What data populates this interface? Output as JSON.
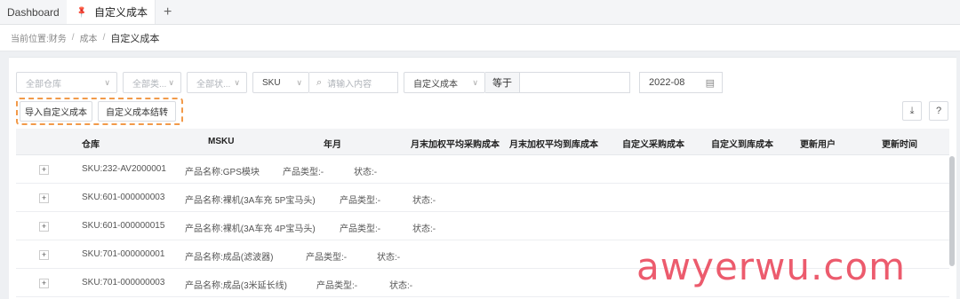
{
  "tabs": {
    "home": "Dashboard",
    "active": "自定义成本",
    "add": "+"
  },
  "breadcrumb": {
    "prefix": "当前位置:",
    "level1": "财务",
    "sep": "/",
    "level2": "成本",
    "current": "自定义成本"
  },
  "filters": {
    "warehouse": "全部仓库",
    "category": "全部类...",
    "status": "全部状...",
    "sku_type": "SKU",
    "search_placeholder": "请输入内容",
    "field": "自定义成本",
    "operator": "等于",
    "date": "2022-08"
  },
  "actions": {
    "import": "导入自定义成本",
    "carryover": "自定义成本结转",
    "download": "⤓",
    "help": "?"
  },
  "columns": [
    "仓库",
    "MSKU",
    "年月",
    "月末加权平均采购成本",
    "月末加权平均到库成本",
    "自定义采购成本",
    "自定义到库成本",
    "更新用户",
    "更新时间"
  ],
  "rows": [
    {
      "sku": "SKU:232-AV2000001",
      "name": "产品名称:GPS模块",
      "type": "产品类型:-",
      "status": "状态:-"
    },
    {
      "sku": "SKU:601-000000003",
      "name": "产品名称:裸机(3A车充 5P宝马头)",
      "type": "产品类型:-",
      "status": "状态:-"
    },
    {
      "sku": "SKU:601-000000015",
      "name": "产品名称:裸机(3A车充 4P宝马头)",
      "type": "产品类型:-",
      "status": "状态:-"
    },
    {
      "sku": "SKU:701-000000001",
      "name": "产品名称:成品(滤波器)",
      "type": "产品类型:-",
      "status": "状态:-"
    },
    {
      "sku": "SKU:701-000000003",
      "name": "产品名称:成品(3米延长线)",
      "type": "产品类型:-",
      "status": "状态:-"
    }
  ],
  "watermark": "awyerwu.com",
  "colors": {
    "highlight": "#f29a4a",
    "watermark": "#ec5b6d",
    "header_bg": "#f3f4f6"
  }
}
